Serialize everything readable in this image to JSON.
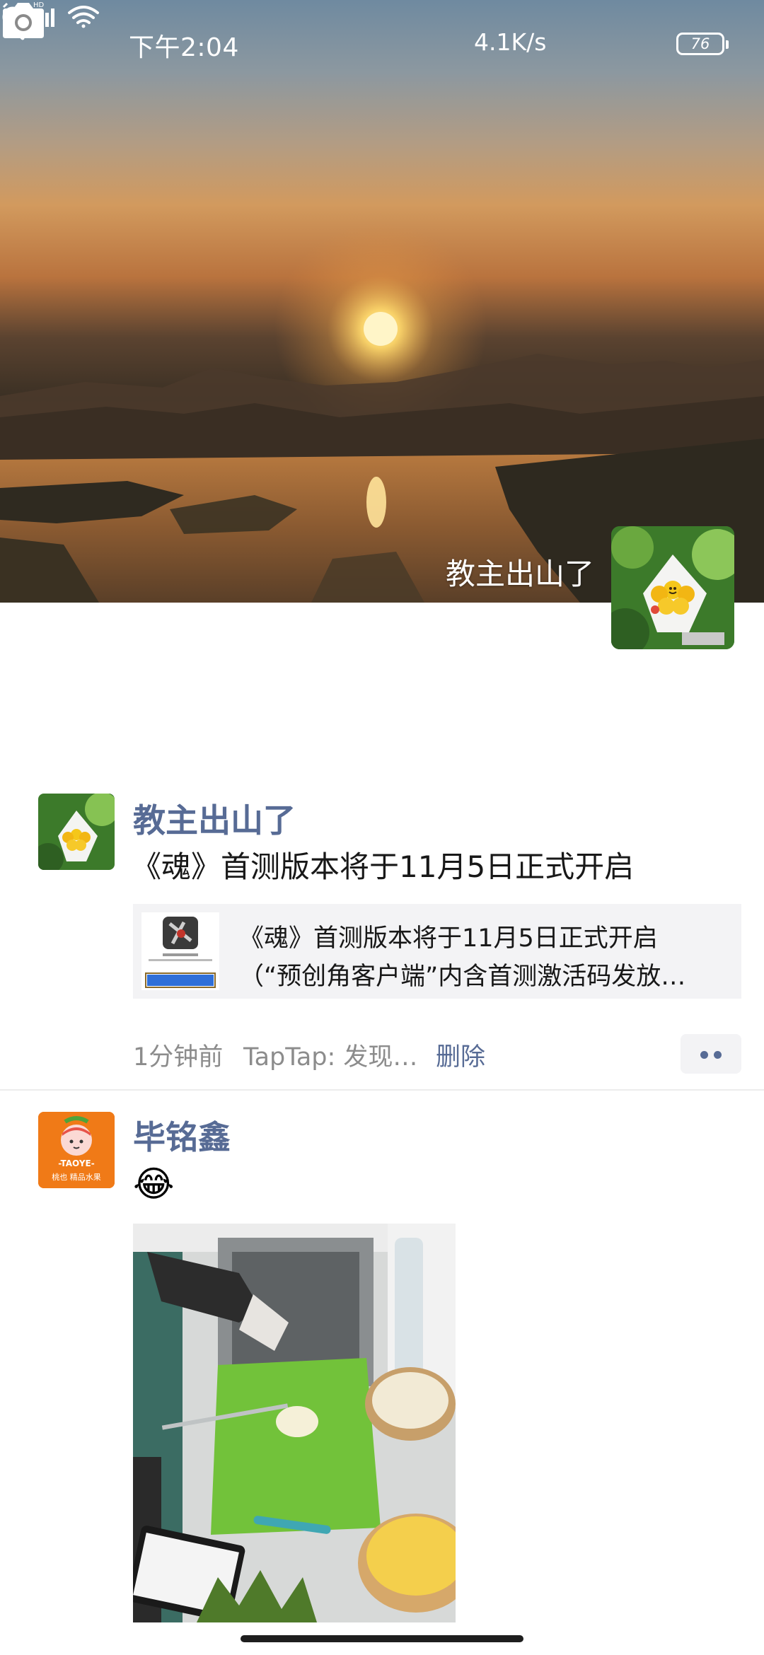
{
  "status_bar": {
    "time": "下午2:04",
    "net_speed": "4.1K/s",
    "battery": "76",
    "icons": [
      "alarm-icon",
      "hd-signal-icon",
      "wifi-icon",
      "battery-icon"
    ]
  },
  "header": {
    "back_icon": "chevron-left-icon",
    "camera_icon": "camera-icon",
    "cover_name": "教主出山了"
  },
  "feed": [
    {
      "name": "教主出山了",
      "text": "《魂》首测版本将于11月5日正式开启",
      "link": {
        "title": "《魂》首测版本将于11月5日正式开启",
        "subtitle": "（“预创角客户端”内含首测激活码发放…"
      },
      "time": "1分钟前",
      "source": "TapTap: 发现…",
      "delete_label": "删除"
    },
    {
      "name": "毕铭鑫",
      "text": "😂",
      "avatar_text": {
        "brand": "-TAOYE-",
        "line2": "桃也 精品水果"
      }
    }
  ],
  "colors": {
    "link_blue": "#576b95",
    "card_bg": "#f3f3f5",
    "avatar_orange": "#f07a17"
  }
}
